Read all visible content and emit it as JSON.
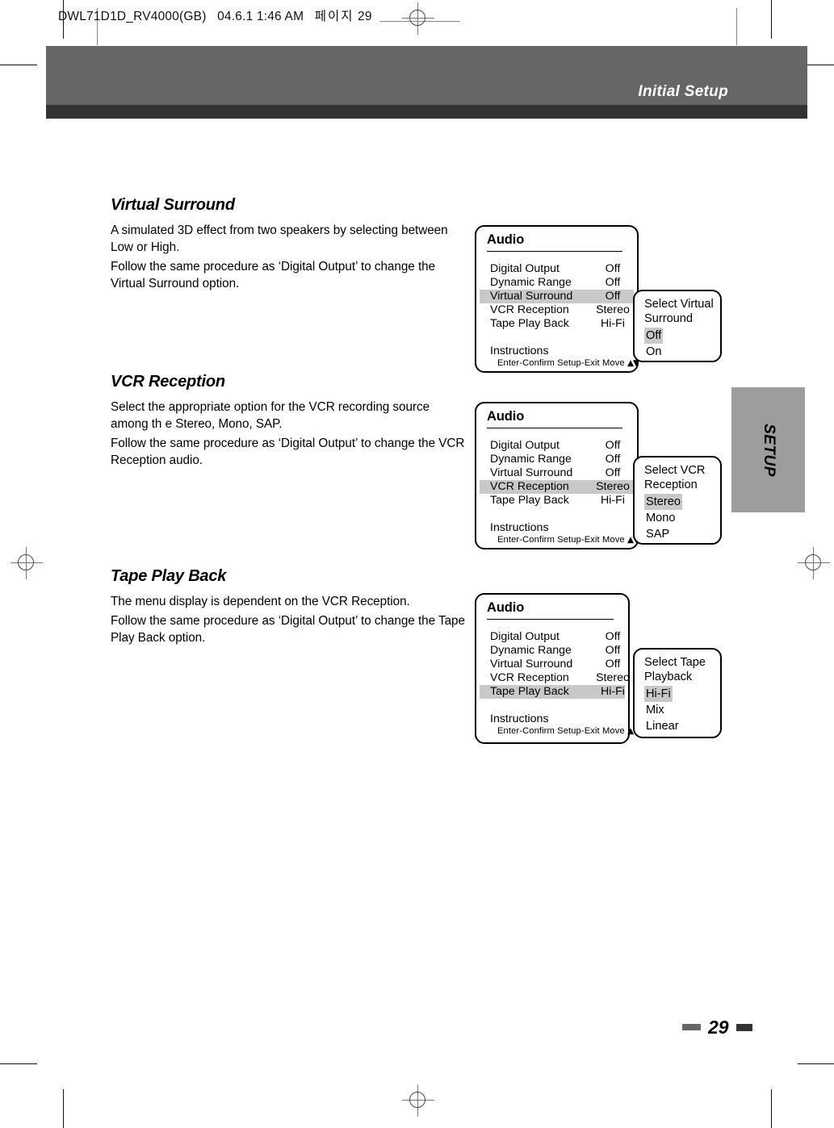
{
  "print_slug": {
    "filename": "DWL71D1D_RV4000(GB)",
    "timestamp": "04.6.1 1:46 AM",
    "korean_label": "페이지",
    "page_ref": "29"
  },
  "header": {
    "running_title": "Initial Setup",
    "banner_color": "#666666",
    "banner_underbar_color": "#333333"
  },
  "side_tab": {
    "label": "SETUP",
    "color": "#9d9d9d"
  },
  "sections": [
    {
      "heading": "Virtual Surround",
      "paragraphs": [
        "A simulated 3D effect from two speakers by selecting between Low or High.",
        "Follow the same procedure as ‘Digital Output’ to change the Virtual Surround option."
      ]
    },
    {
      "heading": "VCR Reception",
      "paragraphs": [
        "Select the appropriate option for the VCR recording source among th e Stereo, Mono, SAP.",
        "Follow the same procedure as ‘Digital Output’ to change the VCR Reception audio."
      ]
    },
    {
      "heading": "Tape Play Back",
      "paragraphs": [
        "The menu display is dependent on the VCR Reception.",
        "Follow the same procedure as ‘Digital Output’ to change the Tape Play Back option."
      ]
    }
  ],
  "osd_common": {
    "title": "Audio",
    "instructions_label": "Instructions",
    "keys_line": "Enter-Confirm  Setup-Exit  Move",
    "move_arrows": "▲▼",
    "highlight_color": "#c9c9c9",
    "rows": [
      {
        "label": "Digital Output",
        "value": "Off"
      },
      {
        "label": "Dynamic Range",
        "value": "Off"
      },
      {
        "label": "Virtual Surround",
        "value": "Off"
      },
      {
        "label": "VCR Reception",
        "value": "Stereo"
      },
      {
        "label": "Tape Play Back",
        "value": "Hi-Fi"
      }
    ]
  },
  "osd_menus": [
    {
      "selected_row_index": 2,
      "submenu": {
        "prompt": "Select Virtual Surround",
        "options": [
          "Off",
          "On"
        ],
        "selected_option": "Off"
      }
    },
    {
      "selected_row_index": 3,
      "submenu": {
        "prompt": "Select VCR Reception",
        "options": [
          "Stereo",
          "Mono",
          "SAP"
        ],
        "selected_option": "Stereo"
      }
    },
    {
      "selected_row_index": 4,
      "submenu": {
        "prompt": "Select Tape Playback",
        "options": [
          "Hi-Fi",
          "Mix",
          "Linear"
        ],
        "selected_option": "Hi-Fi"
      }
    }
  ],
  "folio": {
    "page_number": "29"
  }
}
